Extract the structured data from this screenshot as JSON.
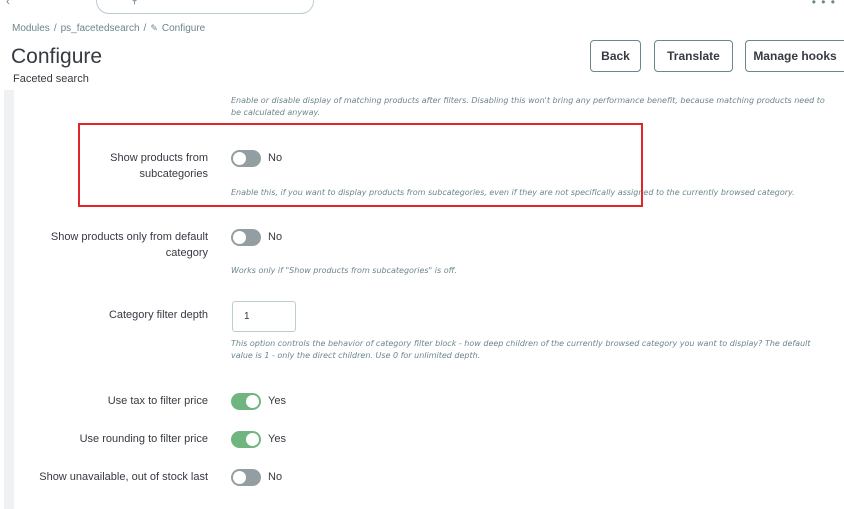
{
  "header": {
    "breadcrumb": [
      "Modules",
      "ps_facetedsearch",
      "Configure"
    ],
    "title": "Configure",
    "subtitle": "Faceted search",
    "buttons": {
      "back": "Back",
      "translate": "Translate",
      "manage_hooks": "Manage hooks"
    }
  },
  "form": {
    "matching_products_help": "Enable or disable display of matching products after filters. Disabling this won't bring any performance benefit, because matching products need to be calculated anyway.",
    "show_subcategories": {
      "label": "Show products from subcategories",
      "state": "No",
      "help": "Enable this, if you want to display products from subcategories, even if they are not specifically assigned to the currently browsed category."
    },
    "show_default_category": {
      "label": "Show products only from default category",
      "state": "No",
      "help": "Works only if \"Show products from subcategories\" is off."
    },
    "category_depth": {
      "label": "Category filter depth",
      "value": "1",
      "help": "This option controls the behavior of category filter block - how deep children of the currently browsed category you want to display? The default value is 1 - only the direct children. Use 0 for unlimited depth."
    },
    "use_tax": {
      "label": "Use tax to filter price",
      "state": "Yes"
    },
    "use_rounding": {
      "label": "Use rounding to filter price",
      "state": "Yes"
    },
    "out_of_stock_last": {
      "label": "Show unavailable, out of stock last",
      "state": "No"
    }
  },
  "colors": {
    "switch_on": "#70b580",
    "switch_off": "#939ea2",
    "highlight": "#e0262b"
  }
}
